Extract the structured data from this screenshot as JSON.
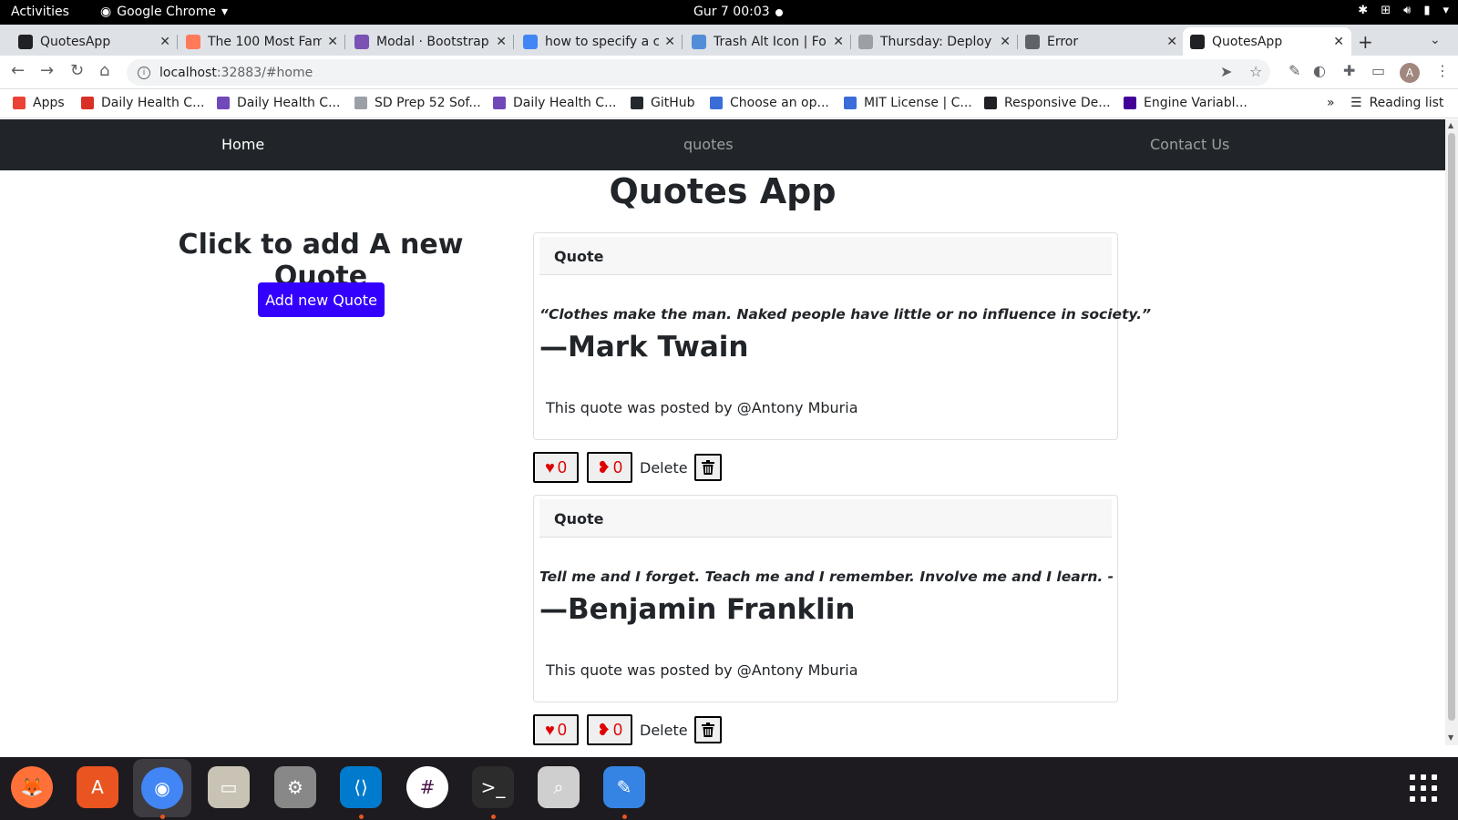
{
  "os": {
    "activities": "Activities",
    "app_name": "Google Chrome",
    "clock": "Gur 7  00:03"
  },
  "tabs": [
    {
      "title": "QuotesApp",
      "favicon": "angular-icon",
      "color": "#202124"
    },
    {
      "title": "The 100 Most Fam",
      "favicon": "hubspot-icon",
      "color": "#ff7a59"
    },
    {
      "title": "Modal · Bootstrap",
      "favicon": "bootstrap-icon",
      "color": "#7952b3"
    },
    {
      "title": "how to specify a c",
      "favicon": "google-icon",
      "color": "#4285f4"
    },
    {
      "title": "Trash Alt Icon | Fo",
      "favicon": "fontawesome-icon",
      "color": "#528dd7"
    },
    {
      "title": "Thursday: Deploy",
      "favicon": "moringa-icon",
      "color": "#9aa0a6"
    },
    {
      "title": "Error",
      "favicon": "globe-icon",
      "color": "#5f6368"
    },
    {
      "title": "QuotesApp",
      "favicon": "angular-icon",
      "color": "#202124",
      "active": true
    }
  ],
  "address_bar": {
    "host": "localhost",
    "path": ":32883/#home"
  },
  "profile_initial": "A",
  "bookmarks": [
    {
      "label": "Apps",
      "icon": "apps-grid-icon"
    },
    {
      "label": "Daily Health C...",
      "icon": "gmail-icon"
    },
    {
      "label": "Daily Health C...",
      "icon": "form-icon"
    },
    {
      "label": "SD Prep 52 Sof...",
      "icon": "moringa-icon"
    },
    {
      "label": "Daily Health C...",
      "icon": "form-icon"
    },
    {
      "label": "GitHub",
      "icon": "github-icon"
    },
    {
      "label": "Choose an op...",
      "icon": "license-icon"
    },
    {
      "label": "MIT License | C...",
      "icon": "license-icon"
    },
    {
      "label": "Responsive De...",
      "icon": "globe-icon"
    },
    {
      "label": "Engine Variabl...",
      "icon": "heroku-icon"
    }
  ],
  "bookmarks_overflow": "»",
  "reading_list": "Reading list",
  "site": {
    "nav": {
      "home": "Home",
      "quotes": "quotes",
      "contact": "Contact Us"
    },
    "title": "Quotes App",
    "add_heading": "Click to add A new Quote",
    "add_button": "Add new Quote",
    "quotes": [
      {
        "header": "Quote",
        "text": "“Clothes make the man. Naked people have little or no influence in society.”",
        "author": "—Mark Twain",
        "posted_by": "This quote was posted by   @Antony Mburia",
        "upvotes": "0",
        "downvotes": "0",
        "delete_label": "Delete"
      },
      {
        "header": "Quote",
        "text": "Tell me and I forget. Teach me and I remember. Involve me and I learn. -",
        "author": "—Benjamin Franklin",
        "posted_by": "This quote was posted by   @Antony Mburia",
        "upvotes": "0",
        "downvotes": "0",
        "delete_label": "Delete"
      }
    ]
  },
  "colors": {
    "navbar_bg": "#212529",
    "primary_button": "#3300ff",
    "heart": "#e00000"
  },
  "dock": [
    {
      "name": "firefox-icon",
      "glyph": "🦊",
      "bg": "#ff7139",
      "running": false
    },
    {
      "name": "software-center-icon",
      "glyph": "A",
      "bg": "#e95420",
      "running": false
    },
    {
      "name": "chrome-icon",
      "glyph": "◉",
      "bg": "#4285f4",
      "running": true,
      "selected": true
    },
    {
      "name": "files-icon",
      "glyph": "▭",
      "bg": "#c9c3b5",
      "running": false
    },
    {
      "name": "settings-icon",
      "glyph": "⚙",
      "bg": "#888888",
      "running": false
    },
    {
      "name": "vscode-icon",
      "glyph": "⟨⟩",
      "bg": "#007acc",
      "running": true
    },
    {
      "name": "slack-icon",
      "glyph": "#",
      "bg": "#ffffff",
      "running": false
    },
    {
      "name": "terminal-icon",
      "glyph": ">_",
      "bg": "#2c2c2c",
      "running": true
    },
    {
      "name": "image-viewer-icon",
      "glyph": "⌕",
      "bg": "#cfcfcf",
      "running": false
    },
    {
      "name": "text-editor-icon",
      "glyph": "✎",
      "bg": "#3584e4",
      "running": true
    }
  ]
}
